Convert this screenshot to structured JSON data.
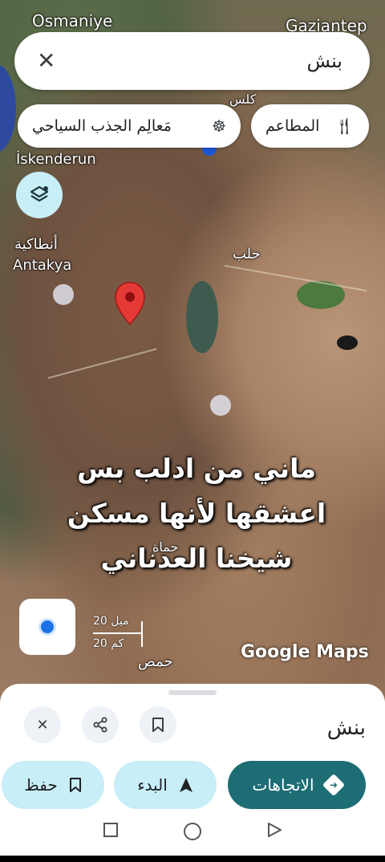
{
  "search": {
    "query": "بنش"
  },
  "chips": {
    "restaurants": "المطاعم",
    "attractions": "مَعالِم الجذب السياحي"
  },
  "map": {
    "labels": {
      "osmaniye": "Osmaniye",
      "gaziantep": "Gaziantep",
      "kilis": "كلس",
      "iskenderun": "İskenderun",
      "antakya_ar": "أنطاكية",
      "antakya": "Antakya",
      "aleppo": "حلب",
      "hama": "حماة",
      "homs": "حمص"
    },
    "scale": {
      "miles": "20 ميل",
      "km": "20 كم"
    },
    "attribution": "Google Maps"
  },
  "caption": {
    "line1": "ماني من ادلب بس",
    "line2": "اعشقها  لأنها مسكن",
    "line3": "شيخنا العدناني"
  },
  "place": {
    "title": "بنش"
  },
  "actions": {
    "directions": "الاتجاهات",
    "start": "البدء",
    "save": "حفظ"
  },
  "colors": {
    "primary": "#1d6d75",
    "secondary": "#c8eef7",
    "pin": "#e53935"
  }
}
